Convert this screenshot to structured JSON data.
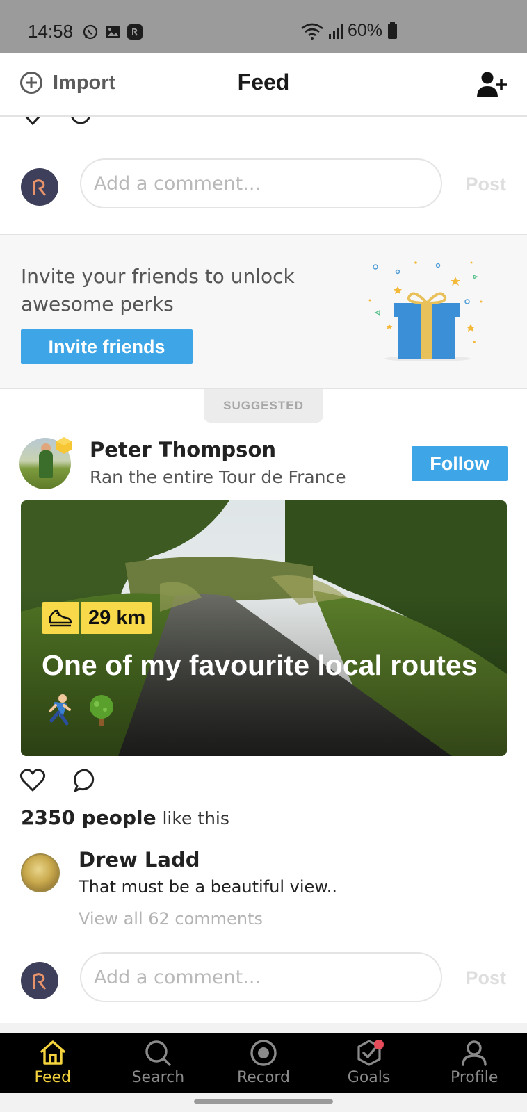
{
  "status_bar": {
    "time": "14:58",
    "battery": "60%"
  },
  "header": {
    "import_label": "Import",
    "title": "Feed"
  },
  "comment_box_top": {
    "placeholder": "Add a comment...",
    "post_label": "Post"
  },
  "invite": {
    "text": "Invite your friends to unlock awesome perks",
    "button_label": "Invite friends"
  },
  "suggested_label": "SUGGESTED",
  "post": {
    "author_name": "Peter Thompson",
    "author_subtitle": "Ran the entire Tour de France",
    "follow_label": "Follow",
    "distance": "29 km",
    "title": "One of my favourite local routes",
    "title_emojis": [
      "runner-emoji",
      "tree-emoji"
    ],
    "likes_count": "2350 people",
    "likes_suffix": "like this",
    "top_comment": {
      "author": "Drew Ladd",
      "text": "That must be a beautiful view.."
    },
    "view_all_comments": "View all 62 comments"
  },
  "comment_box_bottom": {
    "placeholder": "Add a comment...",
    "post_label": "Post"
  },
  "bottom_nav": {
    "items": [
      {
        "label": "Feed",
        "icon": "home-icon",
        "active": true
      },
      {
        "label": "Search",
        "icon": "search-icon",
        "active": false
      },
      {
        "label": "Record",
        "icon": "record-icon",
        "active": false
      },
      {
        "label": "Goals",
        "icon": "goals-icon",
        "active": false,
        "notification_dot": true
      },
      {
        "label": "Profile",
        "icon": "profile-icon",
        "active": false
      }
    ]
  },
  "colors": {
    "accent_blue": "#3ea6e6",
    "tag_yellow": "#f7d94a",
    "nav_active": "#f5d33e",
    "nav_bg": "#000000"
  }
}
